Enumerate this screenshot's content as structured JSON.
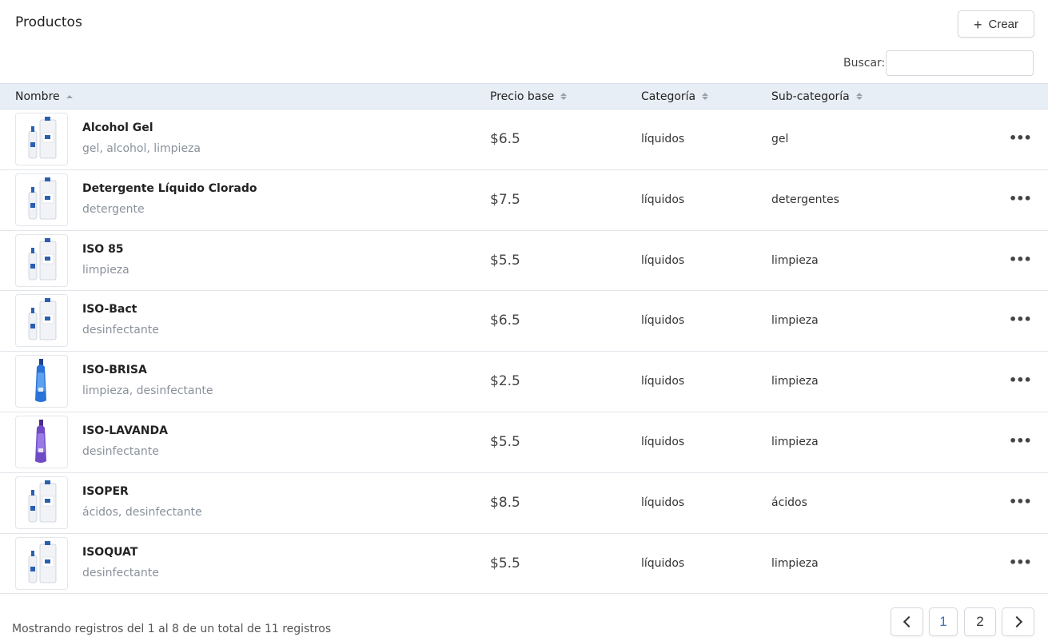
{
  "page": {
    "title": "Productos"
  },
  "toolbar": {
    "create_label": "Crear",
    "create_icon": "plus-icon"
  },
  "search": {
    "label": "Buscar:",
    "value": "",
    "placeholder": ""
  },
  "table": {
    "columns": [
      {
        "label": "Nombre",
        "sort": "asc"
      },
      {
        "label": "Precio base",
        "sort": "none"
      },
      {
        "label": "Categoría",
        "sort": "none"
      },
      {
        "label": "Sub-categoría",
        "sort": "none"
      }
    ],
    "rows": [
      {
        "name": "Alcohol Gel",
        "tags": "gel, alcohol, limpieza",
        "price": "$6.5",
        "category": "líquidos",
        "subcategory": "gel",
        "image": "white-bottles"
      },
      {
        "name": "Detergente Líquido Clorado",
        "tags": "detergente",
        "price": "$7.5",
        "category": "líquidos",
        "subcategory": "detergentes",
        "image": "white-bottles"
      },
      {
        "name": "ISO 85",
        "tags": "limpieza",
        "price": "$5.5",
        "category": "líquidos",
        "subcategory": "limpieza",
        "image": "white-bottles"
      },
      {
        "name": "ISO-Bact",
        "tags": "desinfectante",
        "price": "$6.5",
        "category": "líquidos",
        "subcategory": "limpieza",
        "image": "white-bottles"
      },
      {
        "name": "ISO-BRISA",
        "tags": "limpieza, desinfectante",
        "price": "$2.5",
        "category": "líquidos",
        "subcategory": "limpieza",
        "image": "blue-bottle"
      },
      {
        "name": "ISO-LAVANDA",
        "tags": "desinfectante",
        "price": "$5.5",
        "category": "líquidos",
        "subcategory": "limpieza",
        "image": "purple-bottle"
      },
      {
        "name": "ISOPER",
        "tags": "ácidos, desinfectante",
        "price": "$8.5",
        "category": "líquidos",
        "subcategory": "ácidos",
        "image": "white-bottles"
      },
      {
        "name": "ISOQUAT",
        "tags": "desinfectante",
        "price": "$5.5",
        "category": "líquidos",
        "subcategory": "limpieza",
        "image": "white-bottles"
      }
    ],
    "row_action_icon": "more-horizontal-icon"
  },
  "footer": {
    "summary": "Mostrando registros del 1 al 8 de un total de 11 registros",
    "pages": [
      "1",
      "2"
    ],
    "current_page": "1"
  },
  "colors": {
    "header_bg": "#e8eef6",
    "border": "#e1e5ea",
    "muted_text": "#8a919b",
    "active_page": "#3b6fb6"
  }
}
